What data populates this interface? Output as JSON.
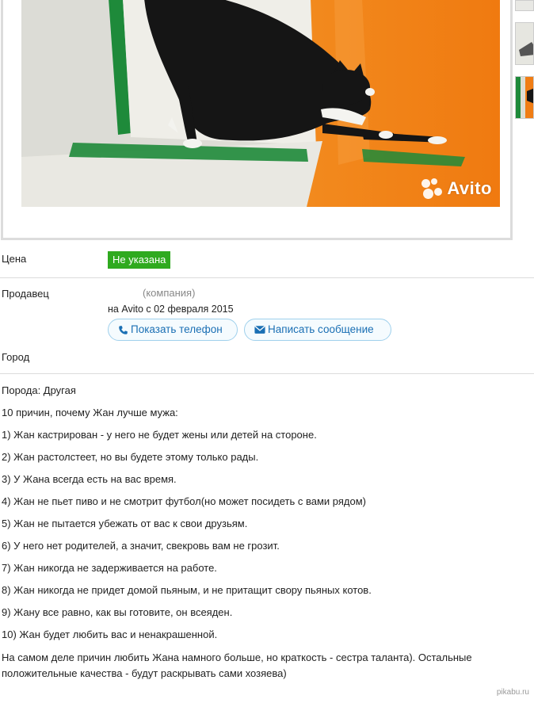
{
  "photo": {
    "watermark": "Avito",
    "accent_colors": {
      "orange": "#f07d14",
      "green": "#1e8a3a",
      "cat": "#151515"
    }
  },
  "listing": {
    "price_label": "Цена",
    "price_value": "Не указана",
    "seller_label": "Продавец",
    "seller_type": "(компания)",
    "seller_since": "на Avito с 02 февраля 2015",
    "city_label": "Город",
    "show_phone_button": "Показать телефон",
    "write_message_button": "Написать сообщение",
    "price_badge_color": "#2faa1f"
  },
  "description": {
    "lines": [
      "Порода: Другая",
      "10 причин, почему Жан лучше мужа:",
      "1) Жан кастрирован - у него не будет жены или детей на стороне.",
      "2) Жан растолстеет, но вы будете этому только рады.",
      "3) У Жана всегда есть на вас время.",
      "4) Жан не пьет пиво и не смотрит футбол(но может посидеть с вами рядом)",
      "5) Жан не пытается убежать от вас к свои друзьям.",
      "6) У него нет родителей, а значит, свекровь вам не грозит.",
      "7) Жан никогда не задерживается на работе.",
      "8) Жан никогда не придет домой пьяным, и не притащит свору пьяных котов.",
      "9) Жану все равно, как вы готовите, он всеяден.",
      "10) Жан будет любить вас и ненакрашенной."
    ],
    "closing": "На самом деле причин любить Жана намного больше, но краткость - сестра таланта). Остальные положительные качества - будут раскрывать сами хозяева)"
  },
  "site_mark": "pikabu.ru"
}
